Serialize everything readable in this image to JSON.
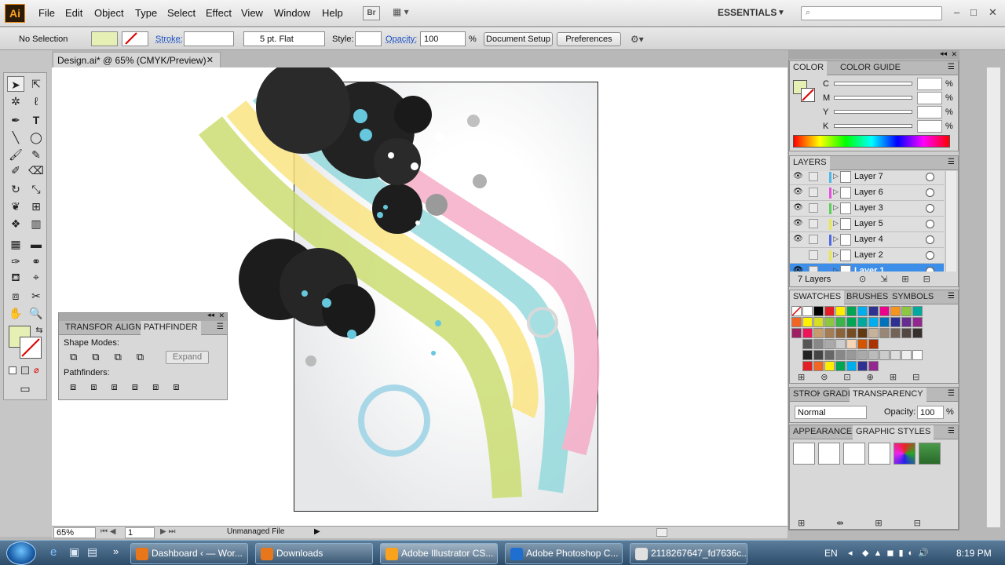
{
  "app": {
    "logo": "Ai",
    "menu": [
      "File",
      "Edit",
      "Object",
      "Type",
      "Select",
      "Effect",
      "View",
      "Window",
      "Help"
    ],
    "bridge_label": "Br",
    "workspace": "ESSENTIALS",
    "search_placeholder": ""
  },
  "control_bar": {
    "selection": "No Selection",
    "stroke_label": "Stroke:",
    "brush": "5 pt. Flat",
    "style_label": "Style:",
    "opacity_label": "Opacity:",
    "opacity_value": "100",
    "percent": "%",
    "doc_setup": "Document Setup",
    "preferences": "Preferences"
  },
  "document": {
    "tab_title": "Design.ai* @ 65% (CMYK/Preview)",
    "zoom": "65%",
    "page": "1",
    "status": "Unmanaged File"
  },
  "pathfinder_panel": {
    "tabs": [
      "TRANSFORM",
      "ALIGN",
      "PATHFINDER"
    ],
    "shape_modes_label": "Shape Modes:",
    "expand_label": "Expand",
    "pathfinders_label": "Pathfinders:"
  },
  "color_panel": {
    "tabs": [
      "COLOR",
      "COLOR GUIDE"
    ],
    "channels": [
      "C",
      "M",
      "Y",
      "K"
    ],
    "percent": "%"
  },
  "layers_panel": {
    "title": "LAYERS",
    "layers": [
      {
        "name": "Layer 7",
        "color": "#4fb8e8",
        "visible": true
      },
      {
        "name": "Layer 6",
        "color": "#e84fe0",
        "visible": true
      },
      {
        "name": "Layer 3",
        "color": "#5ad05a",
        "visible": true
      },
      {
        "name": "Layer 5",
        "color": "#e8e84f",
        "visible": true
      },
      {
        "name": "Layer 4",
        "color": "#4f6ae8",
        "visible": true
      },
      {
        "name": "Layer 2",
        "color": "#e8e84f",
        "visible": false
      },
      {
        "name": "Layer 1",
        "color": "#4f88e8",
        "visible": true,
        "selected": true
      }
    ],
    "count": "7 Layers"
  },
  "swatches_panel": {
    "tabs": [
      "SWATCHES",
      "BRUSHES",
      "SYMBOLS"
    ]
  },
  "transparency_panel": {
    "tabs": [
      "STROKE",
      "GRADIENT",
      "TRANSPARENCY"
    ],
    "blend_mode": "Normal",
    "opacity_label": "Opacity:",
    "opacity_value": "100",
    "percent": "%"
  },
  "appearance_panel": {
    "tabs": [
      "APPEARANCE",
      "GRAPHIC STYLES"
    ]
  },
  "taskbar": {
    "buttons": [
      {
        "label": "Dashboard ‹ — Wor...",
        "color": "#e8761a"
      },
      {
        "label": "Downloads",
        "color": "#e8761a"
      },
      {
        "label": "Adobe Illustrator CS...",
        "color": "#f8a21e",
        "active": true
      },
      {
        "label": "Adobe Photoshop C...",
        "color": "#1f6fd0"
      },
      {
        "label": "2118267647_fd7636c...",
        "color": "#e0e0e0"
      }
    ],
    "language": "EN",
    "time": "8:19 PM"
  }
}
